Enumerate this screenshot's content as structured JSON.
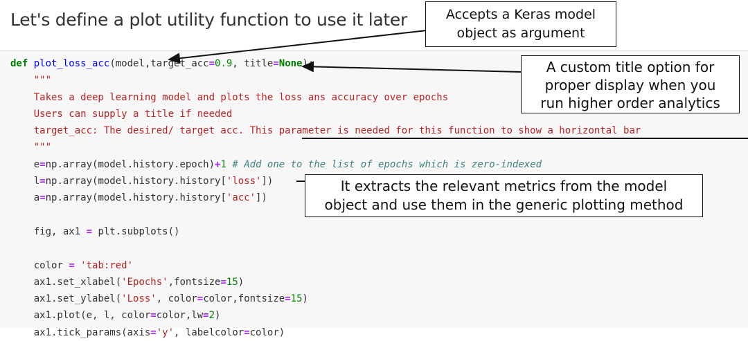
{
  "heading": "Let's define a plot utility function to use it later",
  "code_lines": [
    "def plot_loss_acc(model,target_acc=0.9, title=None):",
    "    \"\"\"",
    "    Takes a deep learning model and plots the loss ans accuracy over epochs",
    "    Users can supply a title if needed",
    "    target_acc: The desired/ target acc. This parameter is needed for this function to show a horizontal bar",
    "    \"\"\"",
    "    e=np.array(model.history.epoch)+1 # Add one to the list of epochs which is zero-indexed",
    "    l=np.array(model.history.history['loss'])",
    "    a=np.array(model.history.history['acc'])",
    "",
    "    fig, ax1 = plt.subplots()",
    "",
    "    color = 'tab:red'",
    "    ax1.set_xlabel('Epochs',fontsize=15)",
    "    ax1.set_ylabel('Loss', color=color,fontsize=15)",
    "    ax1.plot(e, l, color=color,lw=2)",
    "    ax1.tick_params(axis='y', labelcolor=color)"
  ],
  "callouts": {
    "model_arg": {
      "line1": "Accepts a Keras model",
      "line2": "object as argument"
    },
    "title_opt": {
      "line1": "A custom title option for",
      "line2": "proper display when you",
      "line3": "run higher order analytics"
    },
    "metrics": {
      "line1": "It extracts the relevant metrics from the model",
      "line2": "object and use them in the generic plotting method"
    }
  },
  "colors": {
    "keyword": "#008000",
    "function_name": "#0000ff",
    "string": "#ba2121",
    "comment": "#408080",
    "operator": "#aa22ff",
    "cell_background": "#f7f7f7"
  }
}
